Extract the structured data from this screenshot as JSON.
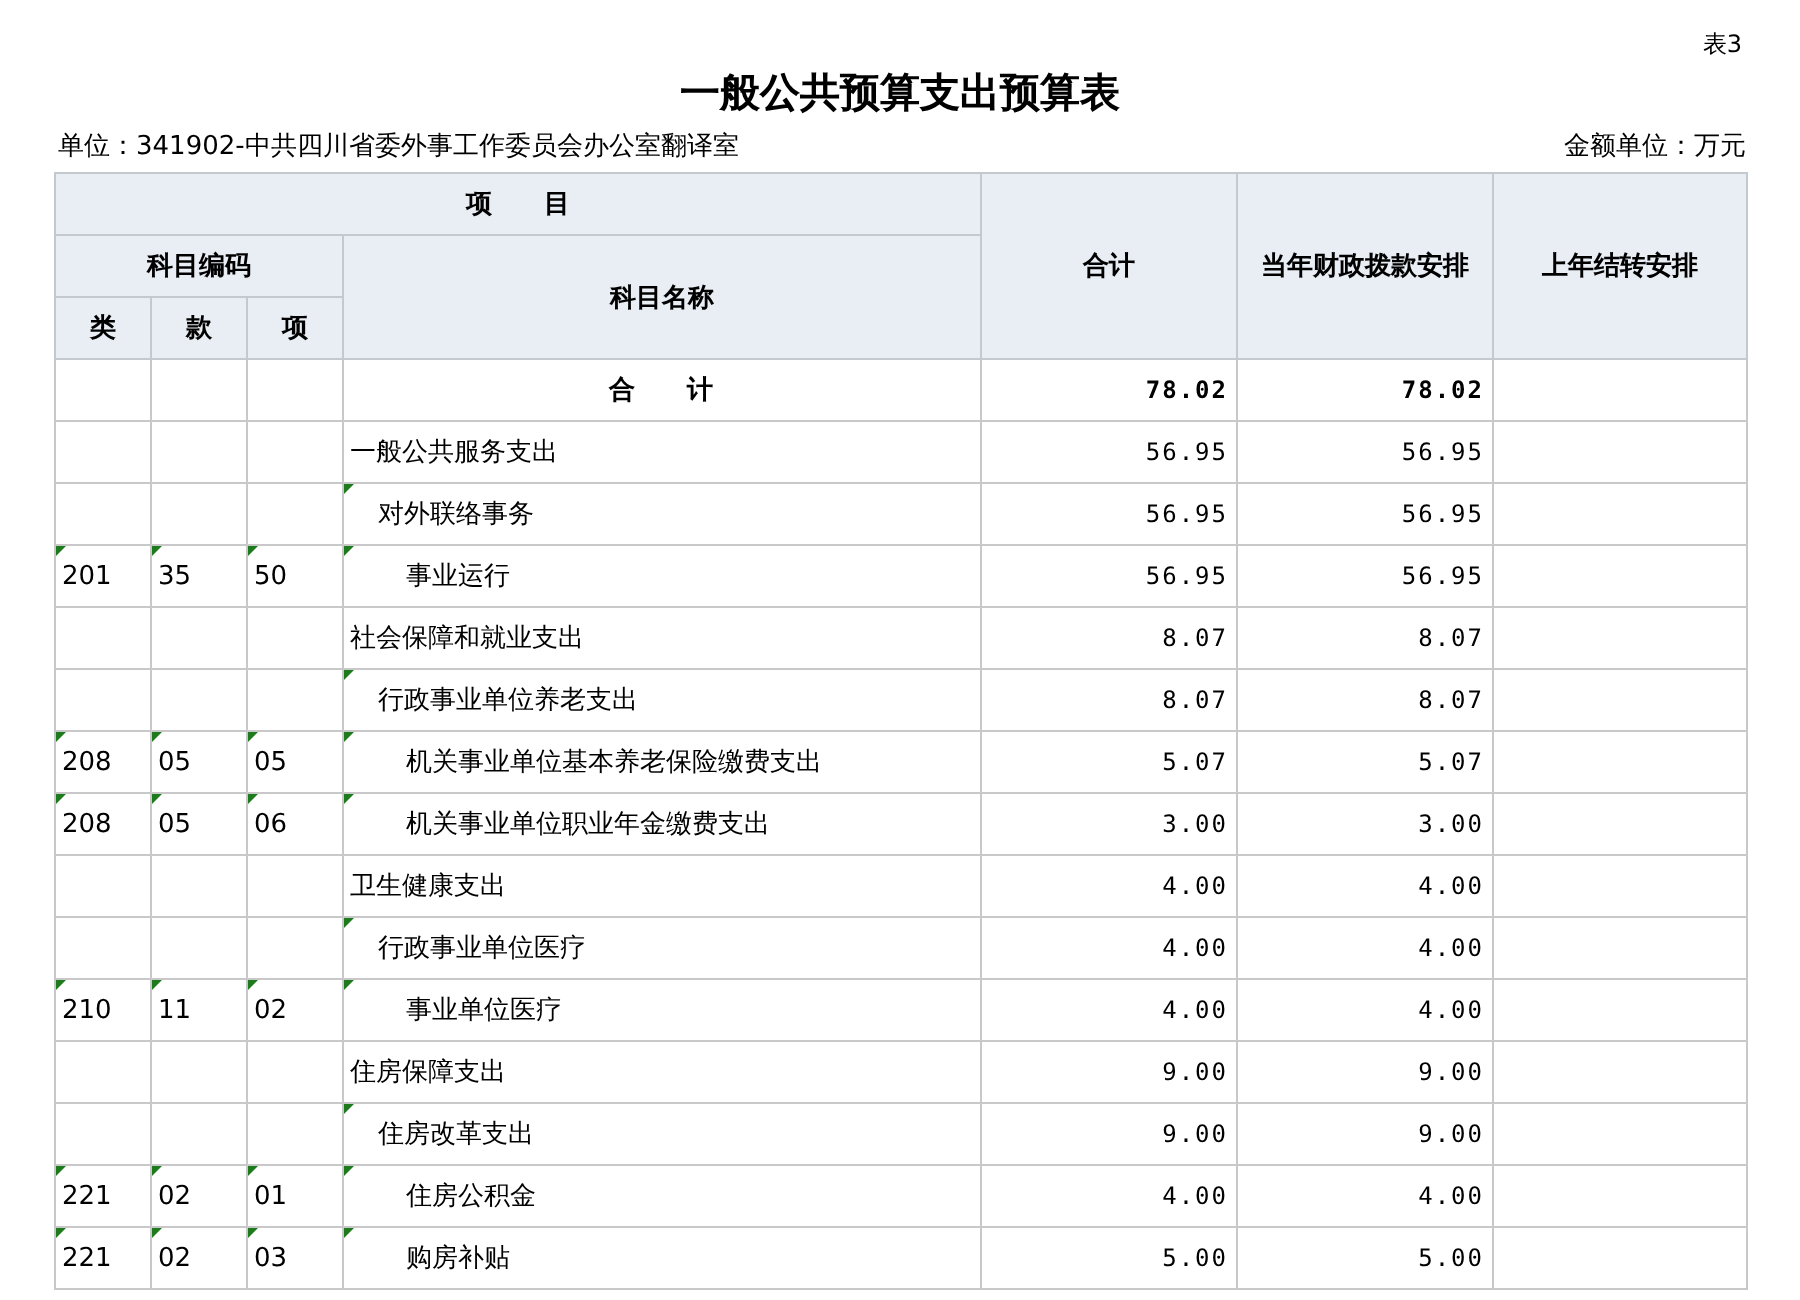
{
  "sheet_label": "表3",
  "title": "一般公共预算支出预算表",
  "unit": "单位：341902-中共四川省委外事工作委员会办公室翻译室",
  "amount_unit": "金额单位：万元",
  "header": {
    "group": "项　　目",
    "code_group": "科目编码",
    "code_columns": [
      "类",
      "款",
      "项"
    ],
    "name_column": "科目名称",
    "value_columns": [
      "合计",
      "当年财政拨款安排",
      "上年结转安排"
    ]
  },
  "rows": [
    {
      "kind": "total",
      "name": "合　　计",
      "values": [
        "78.02",
        "78.02"
      ]
    },
    {
      "kind": "level1",
      "name": "一般公共服务支出",
      "values": [
        "56.95",
        "56.95"
      ]
    },
    {
      "kind": "level2",
      "name": "对外联络事务",
      "values": [
        "56.95",
        "56.95"
      ]
    },
    {
      "kind": "level3",
      "codes": [
        "201",
        "35",
        "50"
      ],
      "name": "事业运行",
      "values": [
        "56.95",
        "56.95"
      ]
    },
    {
      "kind": "level1",
      "name": "社会保障和就业支出",
      "values": [
        "8.07",
        "8.07"
      ]
    },
    {
      "kind": "level2",
      "name": "行政事业单位养老支出",
      "values": [
        "8.07",
        "8.07"
      ]
    },
    {
      "kind": "level3",
      "codes": [
        "208",
        "05",
        "05"
      ],
      "name": "机关事业单位基本养老保险缴费支出",
      "values": [
        "5.07",
        "5.07"
      ]
    },
    {
      "kind": "level3",
      "codes": [
        "208",
        "05",
        "06"
      ],
      "name": "机关事业单位职业年金缴费支出",
      "values": [
        "3.00",
        "3.00"
      ]
    },
    {
      "kind": "level1",
      "name": "卫生健康支出",
      "values": [
        "4.00",
        "4.00"
      ]
    },
    {
      "kind": "level2",
      "name": "行政事业单位医疗",
      "values": [
        "4.00",
        "4.00"
      ]
    },
    {
      "kind": "level3",
      "codes": [
        "210",
        "11",
        "02"
      ],
      "name": "事业单位医疗",
      "values": [
        "4.00",
        "4.00"
      ]
    },
    {
      "kind": "level1",
      "name": "住房保障支出",
      "values": [
        "9.00",
        "9.00"
      ]
    },
    {
      "kind": "level2",
      "name": "住房改革支出",
      "values": [
        "9.00",
        "9.00"
      ]
    },
    {
      "kind": "level3",
      "codes": [
        "221",
        "02",
        "01"
      ],
      "name": "住房公积金",
      "values": [
        "4.00",
        "4.00"
      ]
    },
    {
      "kind": "level3",
      "codes": [
        "221",
        "02",
        "03"
      ],
      "name": "购房补贴",
      "values": [
        "5.00",
        "5.00"
      ]
    }
  ]
}
